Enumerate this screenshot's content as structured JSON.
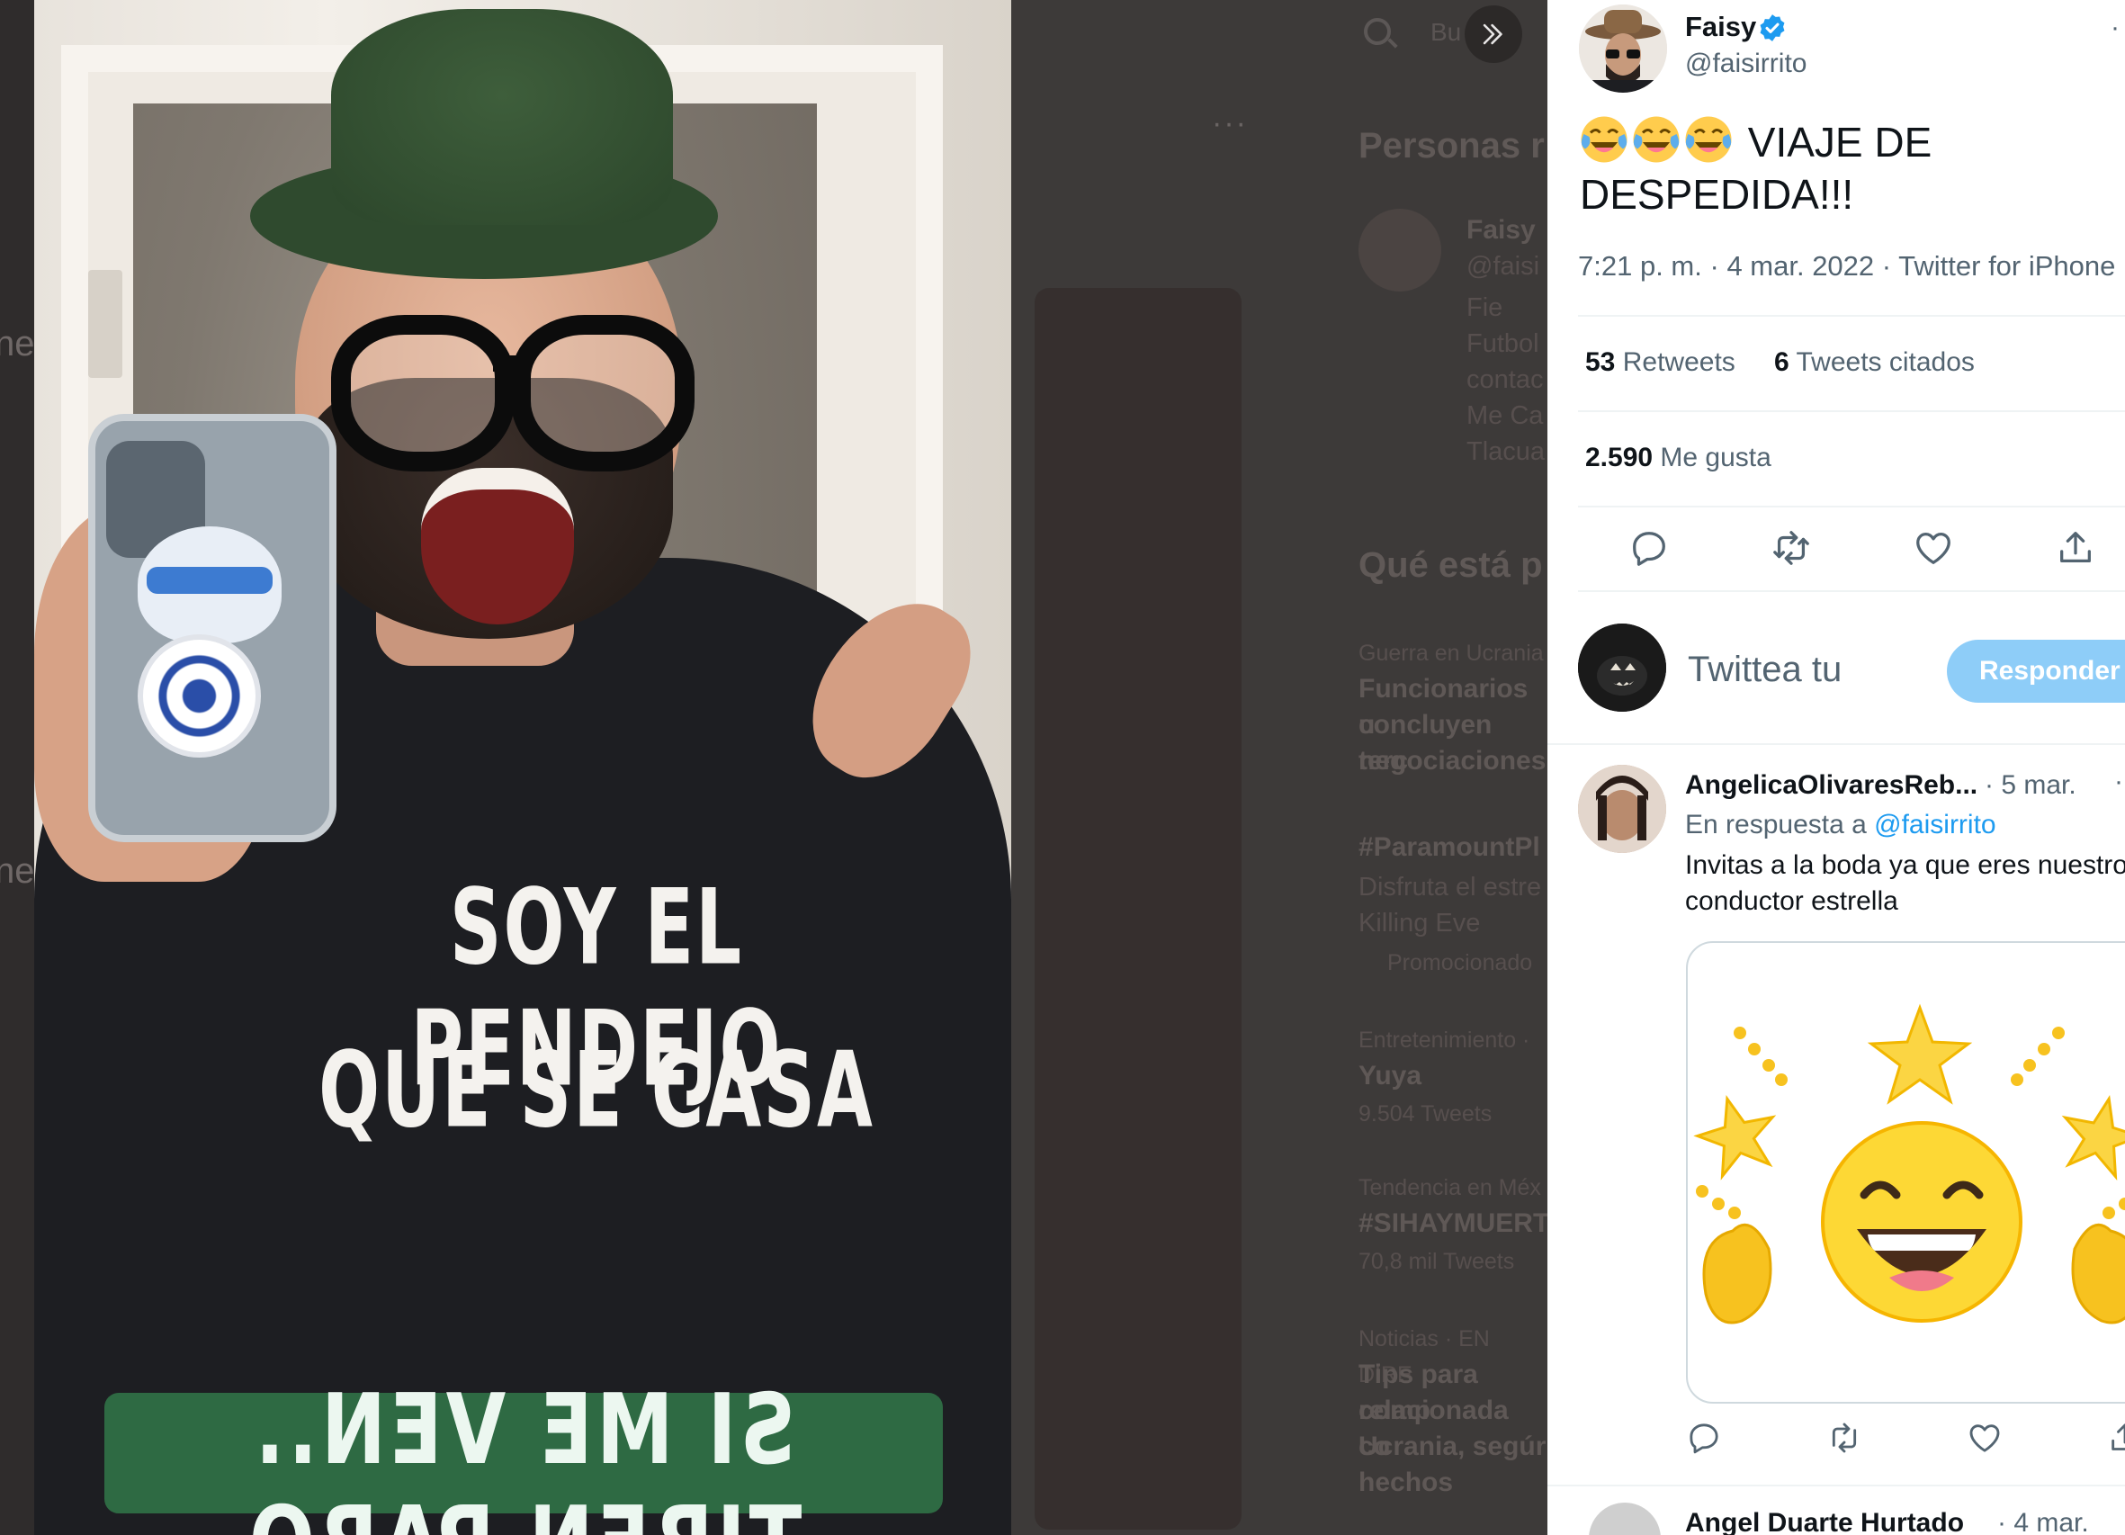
{
  "background": {
    "search_placeholder": "Bu",
    "more": "···",
    "who_to_follow_heading": "Personas r",
    "suggested": {
      "name": "Faisy",
      "handle": "@faisi",
      "bio_lines": [
        "Fie",
        "Futbol",
        "contac",
        "Me Ca",
        "Tlacua"
      ]
    },
    "trends_heading": "Qué está p",
    "trends": [
      {
        "context": "Guerra en Ucrania",
        "title_lines": [
          "Funcionarios u",
          "concluyen terc",
          "negociaciones"
        ]
      },
      {
        "context": "",
        "title_lines": [
          "#ParamountPl"
        ],
        "sub_lines": [
          "Disfruta el estre",
          "Killing Eve"
        ],
        "promo": "Promocionado"
      },
      {
        "context": "Entretenimiento ·",
        "title_lines": [
          "Yuya"
        ],
        "sub_lines": [
          "9.504 Tweets"
        ]
      },
      {
        "context": "Tendencia en Méx",
        "title_lines": [
          "#SIHAYMUERT"
        ],
        "sub_lines": [
          "70,8 mil Tweets"
        ]
      },
      {
        "context": "Noticias · EN DIRE",
        "title_lines": [
          "Tips para comp",
          "relacionada co",
          "Ucrania, segúr",
          "hechos"
        ]
      }
    ],
    "left_fragments": [
      "ne",
      "ne"
    ]
  },
  "photo": {
    "shirt_line1": "SOY EL PENDEJO",
    "shirt_line2": "QUE SE CASA",
    "sticker_text": "SI ME VEN.. TIREN PARO"
  },
  "tweet": {
    "author_name": "Faisy",
    "author_handle": "@faisirrito",
    "text": "VIAJE DE DESPEDIDA!!!",
    "emoji_count": 3,
    "time": "7:21 p. m.",
    "date": "4 mar. 2022",
    "source": "Twitter for iPhone",
    "meta_sep": "·",
    "retweets_count": "53",
    "retweets_label": "Retweets",
    "quotes_count": "6",
    "quotes_label": "Tweets citados",
    "likes_count": "2.590",
    "likes_label": "Me gusta"
  },
  "compose": {
    "placeholder": "Twittea tu",
    "button": "Responder"
  },
  "replies": [
    {
      "name": "AngelicaOlivaresReb...",
      "date": "· 5 mar.",
      "replying_to_label": "En respuesta a",
      "replying_to_handle": "@faisirrito",
      "text": "Invitas a la boda ya que eres nuestro conductor estrella",
      "media": "laughing-sun-sticker"
    },
    {
      "name": "Angel Duarte Hurtado",
      "date": "· 4 mar."
    }
  ],
  "colors": {
    "accent": "#1d9bf0",
    "reply_button": "#8ecdf8",
    "text_primary": "#0f1419",
    "text_secondary": "#536471",
    "sticker_bg": "#2e6a43"
  }
}
